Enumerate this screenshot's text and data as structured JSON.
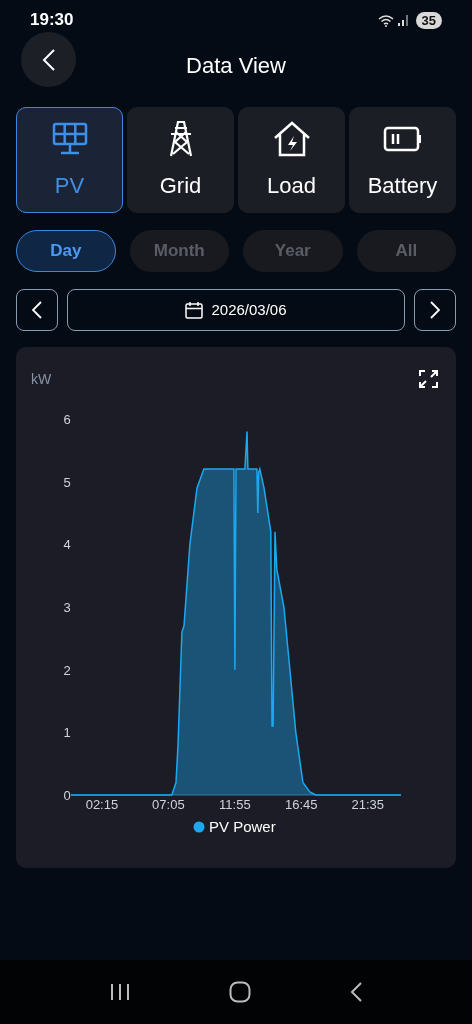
{
  "status_bar": {
    "time": "19:30",
    "battery": "35"
  },
  "header": {
    "title": "Data View"
  },
  "categories": [
    {
      "label": "PV",
      "selected": true
    },
    {
      "label": "Grid",
      "selected": false
    },
    {
      "label": "Load",
      "selected": false
    },
    {
      "label": "Battery",
      "selected": false
    }
  ],
  "periods": [
    {
      "label": "Day",
      "selected": true
    },
    {
      "label": "Month",
      "selected": false
    },
    {
      "label": "Year",
      "selected": false
    },
    {
      "label": "All",
      "selected": false
    }
  ],
  "date_picker": {
    "value": "2026/03/06"
  },
  "chart_data": {
    "type": "area",
    "ylabel": "kW",
    "xlim": [
      0,
      1440
    ],
    "ylim": [
      0,
      6
    ],
    "xticks": [
      {
        "value": 135,
        "label": "02:15"
      },
      {
        "value": 425,
        "label": "07:05"
      },
      {
        "value": 715,
        "label": "11:55"
      },
      {
        "value": 1005,
        "label": "16:45"
      },
      {
        "value": 1295,
        "label": "21:35"
      }
    ],
    "yticks": [
      0,
      1,
      2,
      3,
      4,
      5,
      6
    ],
    "x": [
      0,
      300,
      440,
      458,
      467,
      484,
      493,
      519,
      550,
      580,
      650,
      711,
      715,
      720,
      759,
      768,
      772,
      811,
      815,
      819,
      824,
      842,
      872,
      877,
      882,
      890,
      898,
      929,
      955,
      981,
      1012,
      1042,
      1068,
      1200,
      1440
    ],
    "series": [
      {
        "name": "PV Power",
        "color": "#1ca8f0",
        "values": [
          0,
          0,
          0,
          0.2,
          0.8,
          2.6,
          2.7,
          4.0,
          4.9,
          5.2,
          5.2,
          5.2,
          2.0,
          5.2,
          5.2,
          5.8,
          5.2,
          5.2,
          4.5,
          5.15,
          5.2,
          4.9,
          4.2,
          1.1,
          1.1,
          4.2,
          3.6,
          3.0,
          2.0,
          1.0,
          0.2,
          0.05,
          0,
          0,
          0
        ]
      }
    ]
  }
}
